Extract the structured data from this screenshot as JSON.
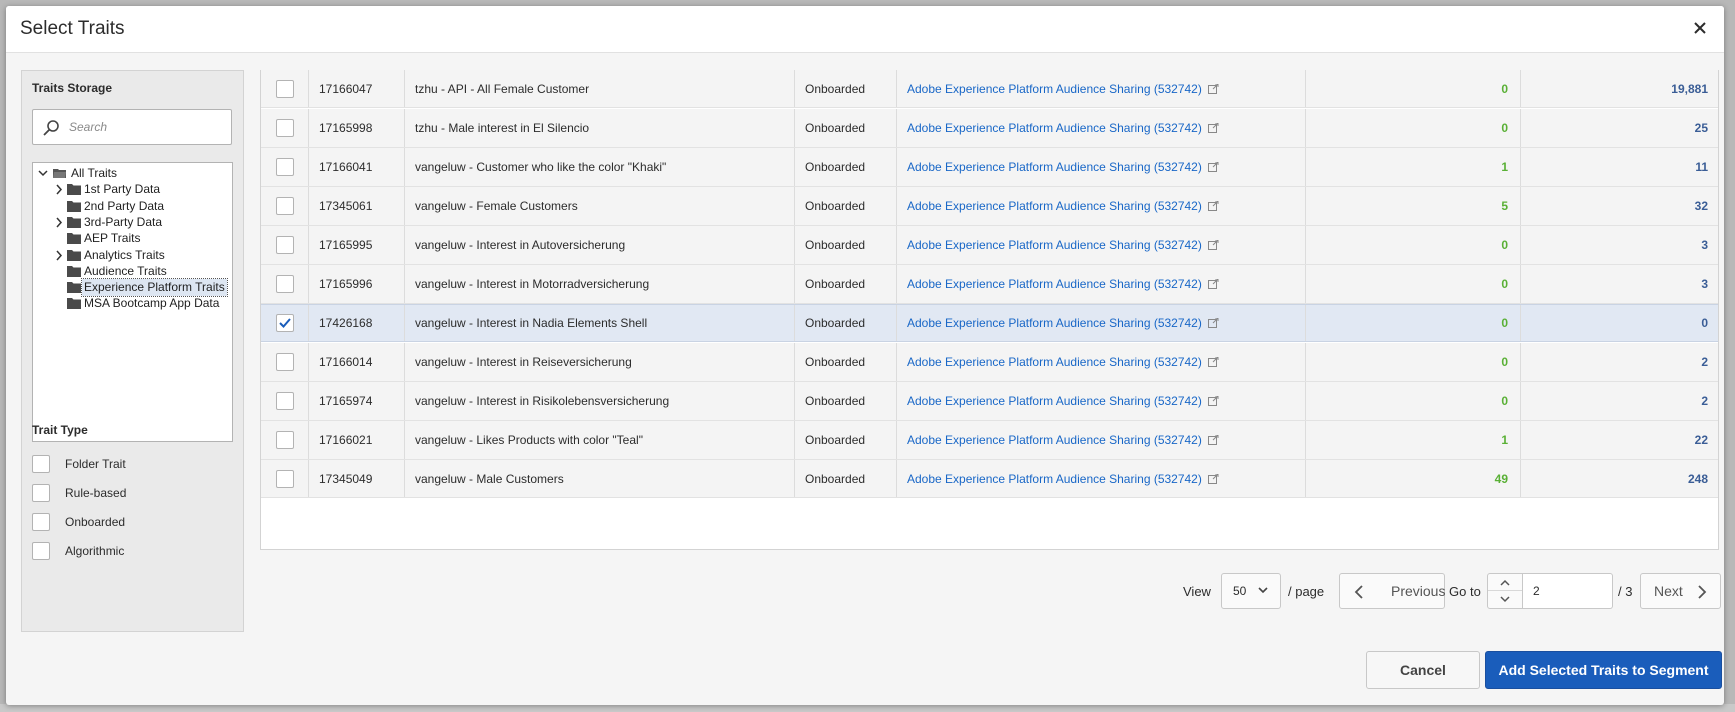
{
  "dialog": {
    "title": "Select Traits",
    "close_icon": "close-icon"
  },
  "storage": {
    "heading": "Traits Storage",
    "search_placeholder": "Search",
    "tree": [
      {
        "label": "All Traits",
        "expanded": true,
        "level": 0
      },
      {
        "label": "1st Party Data",
        "expandable": true,
        "level": 1
      },
      {
        "label": "2nd Party Data",
        "expandable": false,
        "level": 1
      },
      {
        "label": "3rd-Party Data",
        "expandable": true,
        "level": 1
      },
      {
        "label": "AEP Traits",
        "expandable": false,
        "level": 1
      },
      {
        "label": "Analytics Traits",
        "expandable": true,
        "level": 1
      },
      {
        "label": "Audience Traits",
        "expandable": false,
        "level": 1
      },
      {
        "label": "Experience Platform Traits",
        "expandable": false,
        "level": 1,
        "selected": true
      },
      {
        "label": "MSA Bootcamp App Data",
        "expandable": false,
        "level": 1
      }
    ]
  },
  "trait_type": {
    "heading": "Trait Type",
    "options": [
      "Folder Trait",
      "Rule-based",
      "Onboarded",
      "Algorithmic"
    ]
  },
  "rows": [
    {
      "id": "17166047",
      "name": "tzhu - API - All Female Customer",
      "type": "Onboarded",
      "source": "Adobe Experience Platform Audience Sharing (532742)",
      "n1": "0",
      "n2": "19,881",
      "checked": false
    },
    {
      "id": "17165998",
      "name": "tzhu - Male interest in El Silencio",
      "type": "Onboarded",
      "source": "Adobe Experience Platform Audience Sharing (532742)",
      "n1": "0",
      "n2": "25",
      "checked": false
    },
    {
      "id": "17166041",
      "name": "vangeluw - Customer who like the color \"Khaki\"",
      "type": "Onboarded",
      "source": "Adobe Experience Platform Audience Sharing (532742)",
      "n1": "1",
      "n2": "11",
      "checked": false
    },
    {
      "id": "17345061",
      "name": "vangeluw - Female Customers",
      "type": "Onboarded",
      "source": "Adobe Experience Platform Audience Sharing (532742)",
      "n1": "5",
      "n2": "32",
      "checked": false
    },
    {
      "id": "17165995",
      "name": "vangeluw - Interest in Autoversicherung",
      "type": "Onboarded",
      "source": "Adobe Experience Platform Audience Sharing (532742)",
      "n1": "0",
      "n2": "3",
      "checked": false
    },
    {
      "id": "17165996",
      "name": "vangeluw - Interest in Motorradversicherung",
      "type": "Onboarded",
      "source": "Adobe Experience Platform Audience Sharing (532742)",
      "n1": "0",
      "n2": "3",
      "checked": false
    },
    {
      "id": "17426168",
      "name": "vangeluw - Interest in Nadia Elements Shell",
      "type": "Onboarded",
      "source": "Adobe Experience Platform Audience Sharing (532742)",
      "n1": "0",
      "n2": "0",
      "checked": true
    },
    {
      "id": "17166014",
      "name": "vangeluw - Interest in Reiseversicherung",
      "type": "Onboarded",
      "source": "Adobe Experience Platform Audience Sharing (532742)",
      "n1": "0",
      "n2": "2",
      "checked": false
    },
    {
      "id": "17165974",
      "name": "vangeluw - Interest in Risikolebensversicherung",
      "type": "Onboarded",
      "source": "Adobe Experience Platform Audience Sharing (532742)",
      "n1": "0",
      "n2": "2",
      "checked": false
    },
    {
      "id": "17166021",
      "name": "vangeluw - Likes Products with color \"Teal\"",
      "type": "Onboarded",
      "source": "Adobe Experience Platform Audience Sharing (532742)",
      "n1": "1",
      "n2": "22",
      "checked": false
    },
    {
      "id": "17345049",
      "name": "vangeluw - Male Customers",
      "type": "Onboarded",
      "source": "Adobe Experience Platform Audience Sharing (532742)",
      "n1": "49",
      "n2": "248",
      "checked": false
    }
  ],
  "pagination": {
    "view_label": "View",
    "per_page_value": "50",
    "per_page_suffix": "/ page",
    "previous_label": "Previous",
    "goto_label": "Go to",
    "current_page": "2",
    "total_pages_label": "/ 3",
    "next_label": "Next"
  },
  "footer": {
    "cancel_label": "Cancel",
    "submit_label": "Add Selected Traits to Segment"
  },
  "colors": {
    "link": "#1967c7",
    "count_green": "#59b035",
    "count_blue": "#3a5d96",
    "primary": "#1a5dbb",
    "selected_row": "#e1e8f3"
  }
}
